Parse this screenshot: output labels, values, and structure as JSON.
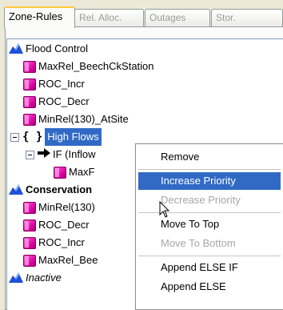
{
  "tabs": [
    "Zone-Rules",
    "Rel. Alloc.",
    "Outages",
    "Stor."
  ],
  "tree": {
    "flood_control": "Flood Control",
    "maxrel_beech": "MaxRel_BeechCkStation",
    "roc_incr_1": "ROC_Incr",
    "roc_decr_1": "ROC_Decr",
    "minrel_atsite": "MinRel(130)_AtSite",
    "braces": "{ }",
    "high_flows": "High Flows",
    "if_inflow": "IF (Inflow",
    "maxf": "MaxF",
    "conservation": "Conservation",
    "minrel_cons": "MinRel(130)",
    "roc_decr_2": "ROC_Decr",
    "roc_incr_2": "ROC_Incr",
    "maxrel_bee": "MaxRel_Bee",
    "inactive": "Inactive"
  },
  "menu": {
    "remove": "Remove",
    "increase_priority": "Increase Priority",
    "decrease_priority": "Decrease Priority",
    "move_to_top": "Move To Top",
    "move_to_bottom": "Move To Bottom",
    "append_else_if": "Append ELSE IF",
    "append_else": "Append ELSE"
  },
  "colors": {
    "selection": "#316ac5",
    "tab_accent": "#ffc83c",
    "rule_icon": "#d6009c",
    "zone_icon": "#1e50d8"
  },
  "icons": [
    "flag-icon",
    "rule-icon",
    "collapse-icon",
    "arrow-right-icon",
    "mouse-cursor-icon"
  ]
}
